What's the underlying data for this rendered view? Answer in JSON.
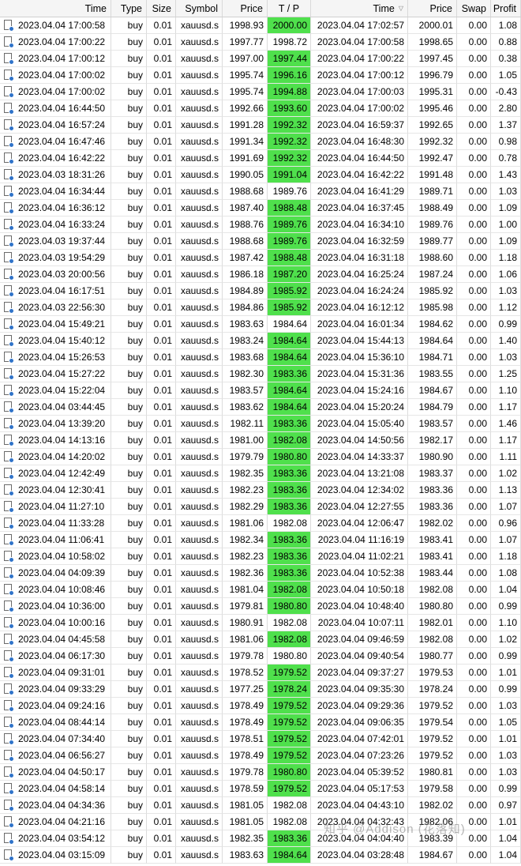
{
  "columns": [
    {
      "label": "Time",
      "key": "open_time"
    },
    {
      "label": "Type",
      "key": "type"
    },
    {
      "label": "Size",
      "key": "size"
    },
    {
      "label": "Symbol",
      "key": "symbol"
    },
    {
      "label": "Price",
      "key": "open_price"
    },
    {
      "label": "T / P",
      "key": "tp"
    },
    {
      "label": "Time",
      "key": "close_time",
      "sort_indicator": "▽"
    },
    {
      "label": "Price",
      "key": "close_price"
    },
    {
      "label": "Swap",
      "key": "swap"
    },
    {
      "label": "Profit",
      "key": "profit"
    }
  ],
  "colors": {
    "header_bg": "#f5f5f5",
    "tp_hit": "#4fe04c",
    "trade_icon": "#2f73c9"
  },
  "icons": {
    "row": "trade-history-icon"
  },
  "watermark": "知乎 @Addison (花落知)",
  "rows": [
    {
      "open_time": "2023.04.04 17:00:58",
      "type": "buy",
      "size": "0.01",
      "symbol": "xauusd.s",
      "open_price": "1998.93",
      "tp": "2000.00",
      "tp_hit": true,
      "close_time": "2023.04.04 17:02:57",
      "close_price": "2000.01",
      "swap": "0.00",
      "profit": "1.08"
    },
    {
      "open_time": "2023.04.04 17:00:22",
      "type": "buy",
      "size": "0.01",
      "symbol": "xauusd.s",
      "open_price": "1997.77",
      "tp": "1998.72",
      "tp_hit": false,
      "close_time": "2023.04.04 17:00:58",
      "close_price": "1998.65",
      "swap": "0.00",
      "profit": "0.88"
    },
    {
      "open_time": "2023.04.04 17:00:12",
      "type": "buy",
      "size": "0.01",
      "symbol": "xauusd.s",
      "open_price": "1997.00",
      "tp": "1997.44",
      "tp_hit": true,
      "close_time": "2023.04.04 17:00:22",
      "close_price": "1997.45",
      "swap": "0.00",
      "profit": "0.38"
    },
    {
      "open_time": "2023.04.04 17:00:02",
      "type": "buy",
      "size": "0.01",
      "symbol": "xauusd.s",
      "open_price": "1995.74",
      "tp": "1996.16",
      "tp_hit": true,
      "close_time": "2023.04.04 17:00:12",
      "close_price": "1996.79",
      "swap": "0.00",
      "profit": "1.05"
    },
    {
      "open_time": "2023.04.04 17:00:02",
      "type": "buy",
      "size": "0.01",
      "symbol": "xauusd.s",
      "open_price": "1995.74",
      "tp": "1994.88",
      "tp_hit": true,
      "close_time": "2023.04.04 17:00:03",
      "close_price": "1995.31",
      "swap": "0.00",
      "profit": "-0.43"
    },
    {
      "open_time": "2023.04.04 16:44:50",
      "type": "buy",
      "size": "0.01",
      "symbol": "xauusd.s",
      "open_price": "1992.66",
      "tp": "1993.60",
      "tp_hit": true,
      "close_time": "2023.04.04 17:00:02",
      "close_price": "1995.46",
      "swap": "0.00",
      "profit": "2.80"
    },
    {
      "open_time": "2023.04.04 16:57:24",
      "type": "buy",
      "size": "0.01",
      "symbol": "xauusd.s",
      "open_price": "1991.28",
      "tp": "1992.32",
      "tp_hit": true,
      "close_time": "2023.04.04 16:59:37",
      "close_price": "1992.65",
      "swap": "0.00",
      "profit": "1.37"
    },
    {
      "open_time": "2023.04.04 16:47:46",
      "type": "buy",
      "size": "0.01",
      "symbol": "xauusd.s",
      "open_price": "1991.34",
      "tp": "1992.32",
      "tp_hit": true,
      "close_time": "2023.04.04 16:48:30",
      "close_price": "1992.32",
      "swap": "0.00",
      "profit": "0.98"
    },
    {
      "open_time": "2023.04.04 16:42:22",
      "type": "buy",
      "size": "0.01",
      "symbol": "xauusd.s",
      "open_price": "1991.69",
      "tp": "1992.32",
      "tp_hit": true,
      "close_time": "2023.04.04 16:44:50",
      "close_price": "1992.47",
      "swap": "0.00",
      "profit": "0.78"
    },
    {
      "open_time": "2023.04.03 18:31:26",
      "type": "buy",
      "size": "0.01",
      "symbol": "xauusd.s",
      "open_price": "1990.05",
      "tp": "1991.04",
      "tp_hit": true,
      "close_time": "2023.04.04 16:42:22",
      "close_price": "1991.48",
      "swap": "0.00",
      "profit": "1.43"
    },
    {
      "open_time": "2023.04.04 16:34:44",
      "type": "buy",
      "size": "0.01",
      "symbol": "xauusd.s",
      "open_price": "1988.68",
      "tp": "1989.76",
      "tp_hit": false,
      "close_time": "2023.04.04 16:41:29",
      "close_price": "1989.71",
      "swap": "0.00",
      "profit": "1.03"
    },
    {
      "open_time": "2023.04.04 16:36:12",
      "type": "buy",
      "size": "0.01",
      "symbol": "xauusd.s",
      "open_price": "1987.40",
      "tp": "1988.48",
      "tp_hit": true,
      "close_time": "2023.04.04 16:37:45",
      "close_price": "1988.49",
      "swap": "0.00",
      "profit": "1.09"
    },
    {
      "open_time": "2023.04.04 16:33:24",
      "type": "buy",
      "size": "0.01",
      "symbol": "xauusd.s",
      "open_price": "1988.76",
      "tp": "1989.76",
      "tp_hit": true,
      "close_time": "2023.04.04 16:34:10",
      "close_price": "1989.76",
      "swap": "0.00",
      "profit": "1.00"
    },
    {
      "open_time": "2023.04.03 19:37:44",
      "type": "buy",
      "size": "0.01",
      "symbol": "xauusd.s",
      "open_price": "1988.68",
      "tp": "1989.76",
      "tp_hit": true,
      "close_time": "2023.04.04 16:32:59",
      "close_price": "1989.77",
      "swap": "0.00",
      "profit": "1.09"
    },
    {
      "open_time": "2023.04.03 19:54:29",
      "type": "buy",
      "size": "0.01",
      "symbol": "xauusd.s",
      "open_price": "1987.42",
      "tp": "1988.48",
      "tp_hit": true,
      "close_time": "2023.04.04 16:31:18",
      "close_price": "1988.60",
      "swap": "0.00",
      "profit": "1.18"
    },
    {
      "open_time": "2023.04.03 20:00:56",
      "type": "buy",
      "size": "0.01",
      "symbol": "xauusd.s",
      "open_price": "1986.18",
      "tp": "1987.20",
      "tp_hit": true,
      "close_time": "2023.04.04 16:25:24",
      "close_price": "1987.24",
      "swap": "0.00",
      "profit": "1.06"
    },
    {
      "open_time": "2023.04.04 16:17:51",
      "type": "buy",
      "size": "0.01",
      "symbol": "xauusd.s",
      "open_price": "1984.89",
      "tp": "1985.92",
      "tp_hit": true,
      "close_time": "2023.04.04 16:24:24",
      "close_price": "1985.92",
      "swap": "0.00",
      "profit": "1.03"
    },
    {
      "open_time": "2023.04.03 22:56:30",
      "type": "buy",
      "size": "0.01",
      "symbol": "xauusd.s",
      "open_price": "1984.86",
      "tp": "1985.92",
      "tp_hit": true,
      "close_time": "2023.04.04 16:12:12",
      "close_price": "1985.98",
      "swap": "0.00",
      "profit": "1.12"
    },
    {
      "open_time": "2023.04.04 15:49:21",
      "type": "buy",
      "size": "0.01",
      "symbol": "xauusd.s",
      "open_price": "1983.63",
      "tp": "1984.64",
      "tp_hit": false,
      "close_time": "2023.04.04 16:01:34",
      "close_price": "1984.62",
      "swap": "0.00",
      "profit": "0.99"
    },
    {
      "open_time": "2023.04.04 15:40:12",
      "type": "buy",
      "size": "0.01",
      "symbol": "xauusd.s",
      "open_price": "1983.24",
      "tp": "1984.64",
      "tp_hit": true,
      "close_time": "2023.04.04 15:44:13",
      "close_price": "1984.64",
      "swap": "0.00",
      "profit": "1.40"
    },
    {
      "open_time": "2023.04.04 15:26:53",
      "type": "buy",
      "size": "0.01",
      "symbol": "xauusd.s",
      "open_price": "1983.68",
      "tp": "1984.64",
      "tp_hit": true,
      "close_time": "2023.04.04 15:36:10",
      "close_price": "1984.71",
      "swap": "0.00",
      "profit": "1.03"
    },
    {
      "open_time": "2023.04.04 15:27:22",
      "type": "buy",
      "size": "0.01",
      "symbol": "xauusd.s",
      "open_price": "1982.30",
      "tp": "1983.36",
      "tp_hit": true,
      "close_time": "2023.04.04 15:31:36",
      "close_price": "1983.55",
      "swap": "0.00",
      "profit": "1.25"
    },
    {
      "open_time": "2023.04.04 15:22:04",
      "type": "buy",
      "size": "0.01",
      "symbol": "xauusd.s",
      "open_price": "1983.57",
      "tp": "1984.64",
      "tp_hit": true,
      "close_time": "2023.04.04 15:24:16",
      "close_price": "1984.67",
      "swap": "0.00",
      "profit": "1.10"
    },
    {
      "open_time": "2023.04.04 03:44:45",
      "type": "buy",
      "size": "0.01",
      "symbol": "xauusd.s",
      "open_price": "1983.62",
      "tp": "1984.64",
      "tp_hit": true,
      "close_time": "2023.04.04 15:20:24",
      "close_price": "1984.79",
      "swap": "0.00",
      "profit": "1.17"
    },
    {
      "open_time": "2023.04.04 13:39:20",
      "type": "buy",
      "size": "0.01",
      "symbol": "xauusd.s",
      "open_price": "1982.11",
      "tp": "1983.36",
      "tp_hit": true,
      "close_time": "2023.04.04 15:05:40",
      "close_price": "1983.57",
      "swap": "0.00",
      "profit": "1.46"
    },
    {
      "open_time": "2023.04.04 14:13:16",
      "type": "buy",
      "size": "0.01",
      "symbol": "xauusd.s",
      "open_price": "1981.00",
      "tp": "1982.08",
      "tp_hit": true,
      "close_time": "2023.04.04 14:50:56",
      "close_price": "1982.17",
      "swap": "0.00",
      "profit": "1.17"
    },
    {
      "open_time": "2023.04.04 14:20:02",
      "type": "buy",
      "size": "0.01",
      "symbol": "xauusd.s",
      "open_price": "1979.79",
      "tp": "1980.80",
      "tp_hit": true,
      "close_time": "2023.04.04 14:33:37",
      "close_price": "1980.90",
      "swap": "0.00",
      "profit": "1.11"
    },
    {
      "open_time": "2023.04.04 12:42:49",
      "type": "buy",
      "size": "0.01",
      "symbol": "xauusd.s",
      "open_price": "1982.35",
      "tp": "1983.36",
      "tp_hit": true,
      "close_time": "2023.04.04 13:21:08",
      "close_price": "1983.37",
      "swap": "0.00",
      "profit": "1.02"
    },
    {
      "open_time": "2023.04.04 12:30:41",
      "type": "buy",
      "size": "0.01",
      "symbol": "xauusd.s",
      "open_price": "1982.23",
      "tp": "1983.36",
      "tp_hit": true,
      "close_time": "2023.04.04 12:34:02",
      "close_price": "1983.36",
      "swap": "0.00",
      "profit": "1.13"
    },
    {
      "open_time": "2023.04.04 11:27:10",
      "type": "buy",
      "size": "0.01",
      "symbol": "xauusd.s",
      "open_price": "1982.29",
      "tp": "1983.36",
      "tp_hit": true,
      "close_time": "2023.04.04 12:27:55",
      "close_price": "1983.36",
      "swap": "0.00",
      "profit": "1.07"
    },
    {
      "open_time": "2023.04.04 11:33:28",
      "type": "buy",
      "size": "0.01",
      "symbol": "xauusd.s",
      "open_price": "1981.06",
      "tp": "1982.08",
      "tp_hit": false,
      "close_time": "2023.04.04 12:06:47",
      "close_price": "1982.02",
      "swap": "0.00",
      "profit": "0.96"
    },
    {
      "open_time": "2023.04.04 11:06:41",
      "type": "buy",
      "size": "0.01",
      "symbol": "xauusd.s",
      "open_price": "1982.34",
      "tp": "1983.36",
      "tp_hit": true,
      "close_time": "2023.04.04 11:16:19",
      "close_price": "1983.41",
      "swap": "0.00",
      "profit": "1.07"
    },
    {
      "open_time": "2023.04.04 10:58:02",
      "type": "buy",
      "size": "0.01",
      "symbol": "xauusd.s",
      "open_price": "1982.23",
      "tp": "1983.36",
      "tp_hit": true,
      "close_time": "2023.04.04 11:02:21",
      "close_price": "1983.41",
      "swap": "0.00",
      "profit": "1.18"
    },
    {
      "open_time": "2023.04.04 04:09:39",
      "type": "buy",
      "size": "0.01",
      "symbol": "xauusd.s",
      "open_price": "1982.36",
      "tp": "1983.36",
      "tp_hit": true,
      "close_time": "2023.04.04 10:52:38",
      "close_price": "1983.44",
      "swap": "0.00",
      "profit": "1.08"
    },
    {
      "open_time": "2023.04.04 10:08:46",
      "type": "buy",
      "size": "0.01",
      "symbol": "xauusd.s",
      "open_price": "1981.04",
      "tp": "1982.08",
      "tp_hit": true,
      "close_time": "2023.04.04 10:50:18",
      "close_price": "1982.08",
      "swap": "0.00",
      "profit": "1.04"
    },
    {
      "open_time": "2023.04.04 10:36:00",
      "type": "buy",
      "size": "0.01",
      "symbol": "xauusd.s",
      "open_price": "1979.81",
      "tp": "1980.80",
      "tp_hit": true,
      "close_time": "2023.04.04 10:48:40",
      "close_price": "1980.80",
      "swap": "0.00",
      "profit": "0.99"
    },
    {
      "open_time": "2023.04.04 10:00:16",
      "type": "buy",
      "size": "0.01",
      "symbol": "xauusd.s",
      "open_price": "1980.91",
      "tp": "1982.08",
      "tp_hit": false,
      "close_time": "2023.04.04 10:07:11",
      "close_price": "1982.01",
      "swap": "0.00",
      "profit": "1.10"
    },
    {
      "open_time": "2023.04.04 04:45:58",
      "type": "buy",
      "size": "0.01",
      "symbol": "xauusd.s",
      "open_price": "1981.06",
      "tp": "1982.08",
      "tp_hit": true,
      "close_time": "2023.04.04 09:46:59",
      "close_price": "1982.08",
      "swap": "0.00",
      "profit": "1.02"
    },
    {
      "open_time": "2023.04.04 06:17:30",
      "type": "buy",
      "size": "0.01",
      "symbol": "xauusd.s",
      "open_price": "1979.78",
      "tp": "1980.80",
      "tp_hit": false,
      "close_time": "2023.04.04 09:40:54",
      "close_price": "1980.77",
      "swap": "0.00",
      "profit": "0.99"
    },
    {
      "open_time": "2023.04.04 09:31:01",
      "type": "buy",
      "size": "0.01",
      "symbol": "xauusd.s",
      "open_price": "1978.52",
      "tp": "1979.52",
      "tp_hit": true,
      "close_time": "2023.04.04 09:37:27",
      "close_price": "1979.53",
      "swap": "0.00",
      "profit": "1.01"
    },
    {
      "open_time": "2023.04.04 09:33:29",
      "type": "buy",
      "size": "0.01",
      "symbol": "xauusd.s",
      "open_price": "1977.25",
      "tp": "1978.24",
      "tp_hit": true,
      "close_time": "2023.04.04 09:35:30",
      "close_price": "1978.24",
      "swap": "0.00",
      "profit": "0.99"
    },
    {
      "open_time": "2023.04.04 09:24:16",
      "type": "buy",
      "size": "0.01",
      "symbol": "xauusd.s",
      "open_price": "1978.49",
      "tp": "1979.52",
      "tp_hit": true,
      "close_time": "2023.04.04 09:29:36",
      "close_price": "1979.52",
      "swap": "0.00",
      "profit": "1.03"
    },
    {
      "open_time": "2023.04.04 08:44:14",
      "type": "buy",
      "size": "0.01",
      "symbol": "xauusd.s",
      "open_price": "1978.49",
      "tp": "1979.52",
      "tp_hit": true,
      "close_time": "2023.04.04 09:06:35",
      "close_price": "1979.54",
      "swap": "0.00",
      "profit": "1.05"
    },
    {
      "open_time": "2023.04.04 07:34:40",
      "type": "buy",
      "size": "0.01",
      "symbol": "xauusd.s",
      "open_price": "1978.51",
      "tp": "1979.52",
      "tp_hit": true,
      "close_time": "2023.04.04 07:42:01",
      "close_price": "1979.52",
      "swap": "0.00",
      "profit": "1.01"
    },
    {
      "open_time": "2023.04.04 06:56:27",
      "type": "buy",
      "size": "0.01",
      "symbol": "xauusd.s",
      "open_price": "1978.49",
      "tp": "1979.52",
      "tp_hit": true,
      "close_time": "2023.04.04 07:23:26",
      "close_price": "1979.52",
      "swap": "0.00",
      "profit": "1.03"
    },
    {
      "open_time": "2023.04.04 04:50:17",
      "type": "buy",
      "size": "0.01",
      "symbol": "xauusd.s",
      "open_price": "1979.78",
      "tp": "1980.80",
      "tp_hit": true,
      "close_time": "2023.04.04 05:39:52",
      "close_price": "1980.81",
      "swap": "0.00",
      "profit": "1.03"
    },
    {
      "open_time": "2023.04.04 04:58:14",
      "type": "buy",
      "size": "0.01",
      "symbol": "xauusd.s",
      "open_price": "1978.59",
      "tp": "1979.52",
      "tp_hit": true,
      "close_time": "2023.04.04 05:17:53",
      "close_price": "1979.58",
      "swap": "0.00",
      "profit": "0.99"
    },
    {
      "open_time": "2023.04.04 04:34:36",
      "type": "buy",
      "size": "0.01",
      "symbol": "xauusd.s",
      "open_price": "1981.05",
      "tp": "1982.08",
      "tp_hit": false,
      "close_time": "2023.04.04 04:43:10",
      "close_price": "1982.02",
      "swap": "0.00",
      "profit": "0.97"
    },
    {
      "open_time": "2023.04.04 04:21:16",
      "type": "buy",
      "size": "0.01",
      "symbol": "xauusd.s",
      "open_price": "1981.05",
      "tp": "1982.08",
      "tp_hit": false,
      "close_time": "2023.04.04 04:32:43",
      "close_price": "1982.06",
      "swap": "0.00",
      "profit": "1.01"
    },
    {
      "open_time": "2023.04.04 03:54:12",
      "type": "buy",
      "size": "0.01",
      "symbol": "xauusd.s",
      "open_price": "1982.35",
      "tp": "1983.36",
      "tp_hit": true,
      "close_time": "2023.04.04 04:04:40",
      "close_price": "1983.39",
      "swap": "0.00",
      "profit": "1.04"
    },
    {
      "open_time": "2023.04.04 03:15:09",
      "type": "buy",
      "size": "0.01",
      "symbol": "xauusd.s",
      "open_price": "1983.63",
      "tp": "1984.64",
      "tp_hit": true,
      "close_time": "2023.04.04 03:28:48",
      "close_price": "1984.67",
      "swap": "0.00",
      "profit": "1.04"
    }
  ]
}
